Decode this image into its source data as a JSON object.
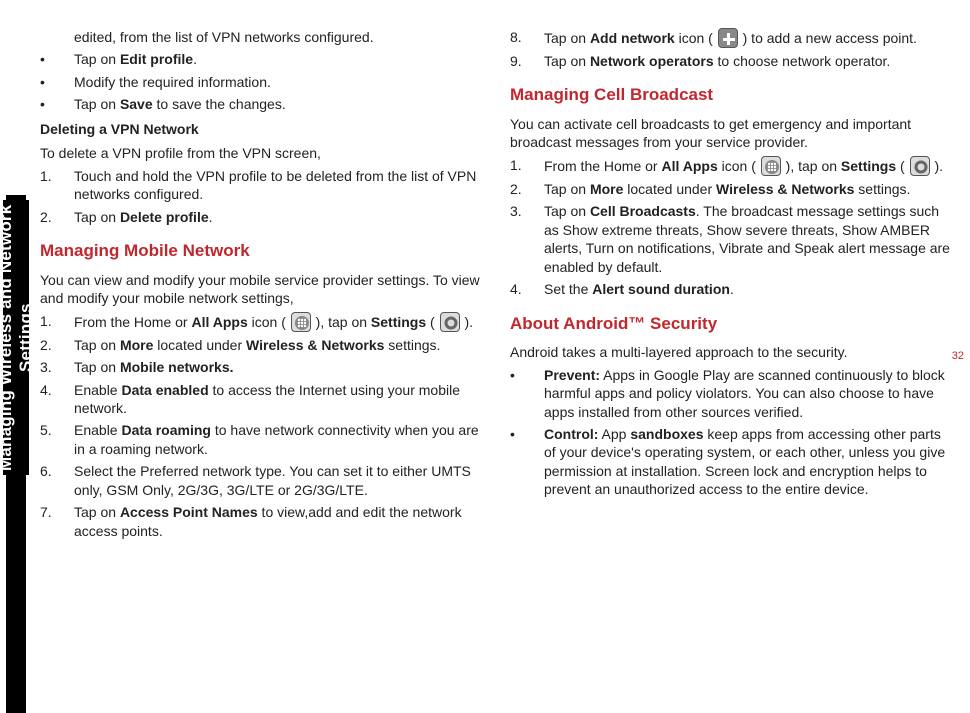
{
  "sidebar_label": "Managing Wireless and Network Settings",
  "page_number": "32",
  "left": {
    "line1": "edited, from the list of VPN networks configured.",
    "b1": {
      "pre": "Tap on ",
      "bold": "Edit profile",
      "post": "."
    },
    "b2": "Modify the required information.",
    "b3": {
      "pre": "Tap on ",
      "bold": "Save",
      "post": " to save the changes."
    },
    "h_del": "Deleting a VPN Network",
    "del_intro": "To delete a VPN profile from the VPN screen,",
    "del1": "Touch and hold the VPN profile to be deleted from the list of VPN networks configured.",
    "del2": {
      "pre": "Tap on ",
      "bold": "Delete profile",
      "post": "."
    },
    "h_mob": "Managing Mobile Network",
    "mob_intro": "You can view and modify your mobile service provider settings. To view and modify your mobile network settings,",
    "m1a": "From the Home or ",
    "m1b": "All Apps",
    "m1c": " icon ( ",
    "m1d": " ), tap on ",
    "m1e": "Settings",
    "m1f": " ( ",
    "m1g": " ).",
    "m2a": "Tap on ",
    "m2b": "More",
    "m2c": " located under ",
    "m2d": "Wireless & Networks",
    "m2e": " settings.",
    "m3a": "Tap on ",
    "m3b": "Mobile networks.",
    "m4a": "Enable ",
    "m4b": "Data enabled",
    "m4c": " to access the Internet using your mobile network.",
    "m5a": "Enable ",
    "m5b": "Data roaming",
    "m5c": " to have network connectivity when you are in a roaming network.",
    "m6": "Select the Preferred network type. You can set it to either UMTS only, GSM Only, 2G/3G, 3G/LTE or 2G/3G/LTE.",
    "m7a": "Tap on ",
    "m7b": "Access Point Names",
    "m7c": " to view,add and edit the network access points."
  },
  "right": {
    "r8a": "Tap on ",
    "r8b": "Add network",
    "r8c": " icon ( ",
    "r8d": " ) to add a new access point.",
    "r9a": "Tap on ",
    "r9b": "Network operators",
    "r9c": " to choose network operator.",
    "h_cell": "Managing Cell Broadcast",
    "cell_intro": "You can activate cell broadcasts to get emergency and important broadcast messages from your service provider.",
    "c1a": "From the Home or ",
    "c1b": "All Apps",
    "c1c": " icon ( ",
    "c1d": " ), tap on ",
    "c1e": "Settings",
    "c1f": " ( ",
    "c1g": " ).",
    "c2a": "Tap on ",
    "c2b": "More",
    "c2c": " located under ",
    "c2d": "Wireless & Networks",
    "c2e": " settings.",
    "c3a": "Tap on ",
    "c3b": "Cell Broadcasts",
    "c3c": ". The broadcast message settings such as Show extreme threats, Show severe threats, Show AMBER alerts, Turn on notifications, Vibrate and Speak alert message are enabled by default.",
    "c4a": "Set the ",
    "c4b": "Alert sound duration",
    "c4c": ".",
    "h_sec": "About Android™ Security",
    "sec_intro": "Android takes a multi-layered approach to the security.",
    "s1a": "Prevent:",
    "s1b": " Apps in Google Play are scanned continuously to block harmful apps and policy violators. You can also choose to have apps installed from other sources verified.",
    "s2a": "Control:",
    "s2b": " App ",
    "s2c": "sandboxes",
    "s2d": " keep apps from accessing other parts of your device's operating system, or each other, unless you give permission at installation. Screen lock and encryption helps to prevent an unauthorized access to the entire device."
  }
}
